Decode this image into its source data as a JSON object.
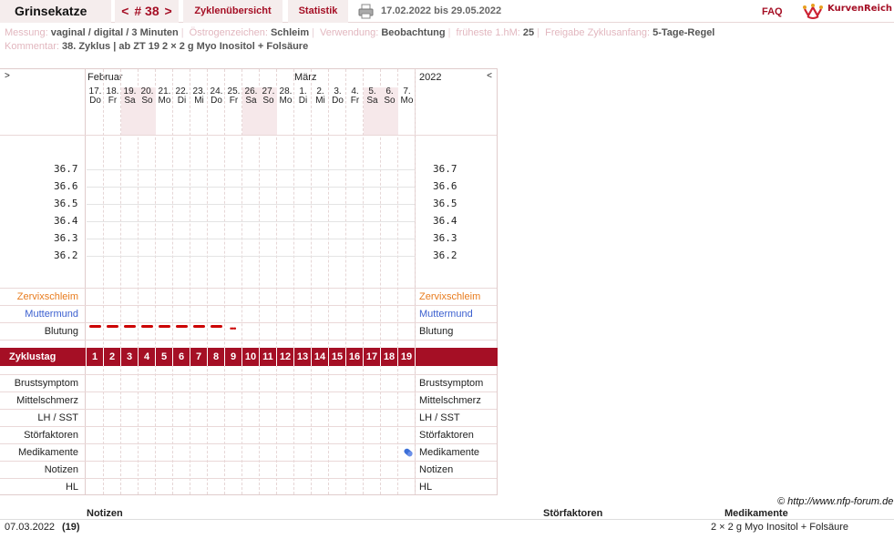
{
  "header": {
    "user": "Grinsekatze",
    "cycle_prev": "<",
    "cycle_label": "# 38",
    "cycle_next": ">",
    "tab_overview": "Zyklenübersicht",
    "tab_stats": "Statistik",
    "date_range": "17.02.2022 bis 29.05.2022",
    "faq": "FAQ",
    "logo_text": "KurvenReich"
  },
  "meta": {
    "messung_label": "Messung:",
    "messung_value": "vaginal / digital / 3 Minuten",
    "oestrogen_label": "Östrogenzeichen:",
    "oestrogen_value": "Schleim",
    "verwendung_label": "Verwendung:",
    "verwendung_value": "Beobachtung",
    "hm_label": "früheste 1.hM:",
    "hm_value": "25",
    "freigabe_label": "Freigabe Zyklusanfang:",
    "freigabe_value": "5-Tage-Regel",
    "kommentar_label": "Kommentar:",
    "kommentar_value": "38. Zyklus | ab ZT 19 2 × 2 g Myo Inositol + Folsäure"
  },
  "chart": {
    "nav_left": ">",
    "nav_right": "<",
    "month1": "Februar",
    "month2": "März",
    "year": "2022",
    "days": [
      {
        "d": "17.",
        "w": "Do",
        "we": false
      },
      {
        "d": "18.",
        "w": "Fr",
        "we": false
      },
      {
        "d": "19.",
        "w": "Sa",
        "we": true
      },
      {
        "d": "20.",
        "w": "So",
        "we": true
      },
      {
        "d": "21.",
        "w": "Mo",
        "we": false
      },
      {
        "d": "22.",
        "w": "Di",
        "we": false
      },
      {
        "d": "23.",
        "w": "Mi",
        "we": false
      },
      {
        "d": "24.",
        "w": "Do",
        "we": false
      },
      {
        "d": "25.",
        "w": "Fr",
        "we": false
      },
      {
        "d": "26.",
        "w": "Sa",
        "we": true
      },
      {
        "d": "27.",
        "w": "So",
        "we": true
      },
      {
        "d": "28.",
        "w": "Mo",
        "we": false
      },
      {
        "d": "1.",
        "w": "Di",
        "we": false
      },
      {
        "d": "2.",
        "w": "Mi",
        "we": false
      },
      {
        "d": "3.",
        "w": "Do",
        "we": false
      },
      {
        "d": "4.",
        "w": "Fr",
        "we": false
      },
      {
        "d": "5.",
        "w": "Sa",
        "we": true
      },
      {
        "d": "6.",
        "w": "So",
        "we": true
      },
      {
        "d": "7.",
        "w": "Mo",
        "we": false
      }
    ],
    "temps": [
      "36.7",
      "36.6",
      "36.5",
      "36.4",
      "36.3",
      "36.2"
    ],
    "rows_top": {
      "zervix": "Zervixschleim",
      "muttermund": "Muttermund",
      "blutung": "Blutung"
    },
    "zyklustag_label": "Zyklustag",
    "cycle_days": [
      "1",
      "2",
      "3",
      "4",
      "5",
      "6",
      "7",
      "8",
      "9",
      "10",
      "11",
      "12",
      "13",
      "14",
      "15",
      "16",
      "17",
      "18",
      "19"
    ],
    "bleeding_days": 8,
    "spotting_day": 9,
    "rows_bottom": [
      "Brustsymptom",
      "Mittelschmerz",
      "LH / SST",
      "Störfaktoren",
      "Medikamente",
      "Notizen",
      "HL"
    ],
    "medication_day": 19
  },
  "colors": {
    "accent": "#a50f25",
    "zervix": "#e87c1e",
    "muttermund": "#3b5fcf",
    "bleeding": "#cc0000",
    "pill": "#3b6fd8"
  },
  "copyright": "© http://www.nfp-forum.de",
  "notes_table": {
    "h_notizen": "Notizen",
    "h_stoer": "Störfaktoren",
    "h_med": "Medikamente",
    "row_date": "07.03.2022",
    "row_day": "(19)",
    "row_med": "2 × 2 g Myo Inositol + Folsäure"
  }
}
